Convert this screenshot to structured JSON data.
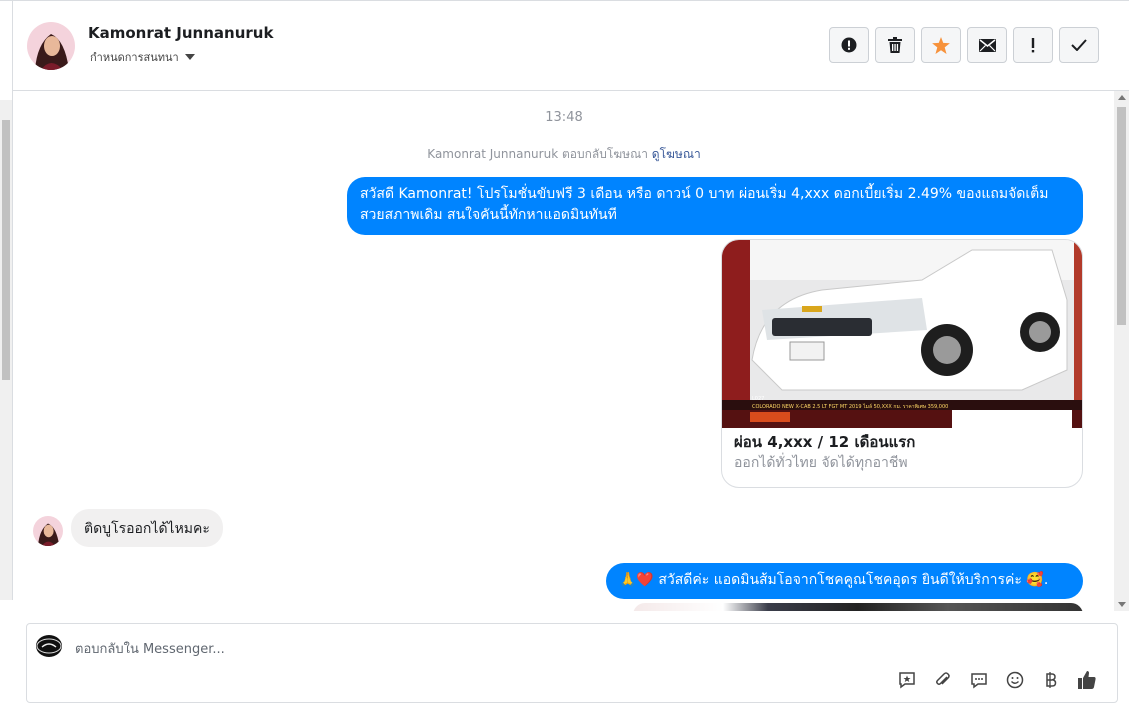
{
  "header": {
    "name": "Kamonrat Junnanuruk",
    "assign_label": "กำหนดการสนทนา"
  },
  "actions": [
    {
      "id": "report",
      "icon": "alert-circle-icon"
    },
    {
      "id": "delete",
      "icon": "trash-icon"
    },
    {
      "id": "star",
      "icon": "star-icon"
    },
    {
      "id": "mark-unread",
      "icon": "envelope-icon"
    },
    {
      "id": "important",
      "icon": "exclamation-icon"
    },
    {
      "id": "done",
      "icon": "check-icon"
    }
  ],
  "thread": {
    "timestamp": "13:48",
    "reply_note": "Kamonrat Junnanuruk ตอบกลับโฆษณา",
    "reply_note_link": "ดูโฆษณา",
    "msg1": "สวัสดี Kamonrat! โปรโมชั่นขับฟรี 3 เดือน หรือ ดาวน์ 0 บาท ผ่อนเริ่ม 4,xxx ดอกเบี้ยเริ่ม 2.49% ของแถมจัดเต็ม สวยสภาพเดิม สนใจคันนี้ทักหาแอดมินทันที",
    "card": {
      "title": "ผ่อน 4,xxx / 12 เดือนแรก",
      "description": "ออกได้ทั่วไทย จัดได้ทุกอาชีพ",
      "image_caption": "COLORADO NEW X-CAB 2.5 LT FGT MT 2019 ไมล์ 50,XXX กม. ราคาพิเศษ 359,000",
      "image_tag": "L027"
    },
    "incoming_msg": "ติดบูโรออกได้ไหมคะ",
    "msg2": "🙏❤️ สวัสดีค่ะ แอดมินส้มโอจากโชคคูณโชคอุดร ยินดีให้บริการค่ะ 🥰."
  },
  "composer": {
    "placeholder": "ตอบกลับใน Messenger..."
  },
  "colors": {
    "outgoing": "#0084ff",
    "incoming": "#f1f0f0",
    "star": "#f7923b"
  }
}
